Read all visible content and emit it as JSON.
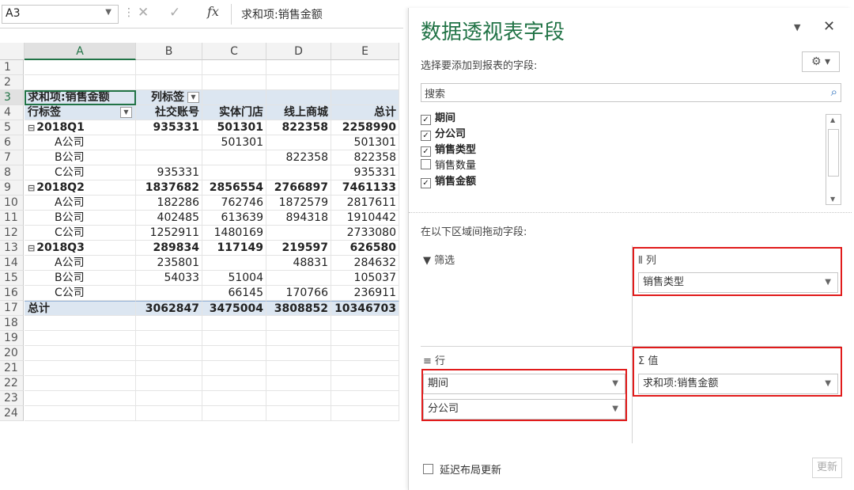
{
  "formula_bar": {
    "name_box": "A3",
    "fx": "fx",
    "formula": "求和项:销售金额"
  },
  "columns": [
    "A",
    "B",
    "C",
    "D",
    "E"
  ],
  "rows": [
    {
      "n": "1",
      "cells": [
        "",
        "",
        "",
        "",
        ""
      ]
    },
    {
      "n": "2",
      "cells": [
        "",
        "",
        "",
        "",
        ""
      ]
    },
    {
      "n": "3",
      "cells": [
        "求和项:销售金额",
        "列标签",
        "",
        "",
        ""
      ]
    },
    {
      "n": "4",
      "cells": [
        "行标签",
        "社交账号",
        "实体门店",
        "线上商城",
        "总计"
      ]
    },
    {
      "n": "5",
      "cells": [
        "2018Q1",
        "935331",
        "501301",
        "822358",
        "2258990"
      ]
    },
    {
      "n": "6",
      "cells": [
        "A公司",
        "",
        "501301",
        "",
        "501301"
      ]
    },
    {
      "n": "7",
      "cells": [
        "B公司",
        "",
        "",
        "822358",
        "822358"
      ]
    },
    {
      "n": "8",
      "cells": [
        "C公司",
        "935331",
        "",
        "",
        "935331"
      ]
    },
    {
      "n": "9",
      "cells": [
        "2018Q2",
        "1837682",
        "2856554",
        "2766897",
        "7461133"
      ]
    },
    {
      "n": "10",
      "cells": [
        "A公司",
        "182286",
        "762746",
        "1872579",
        "2817611"
      ]
    },
    {
      "n": "11",
      "cells": [
        "B公司",
        "402485",
        "613639",
        "894318",
        "1910442"
      ]
    },
    {
      "n": "12",
      "cells": [
        "C公司",
        "1252911",
        "1480169",
        "",
        "2733080"
      ]
    },
    {
      "n": "13",
      "cells": [
        "2018Q3",
        "289834",
        "117149",
        "219597",
        "626580"
      ]
    },
    {
      "n": "14",
      "cells": [
        "A公司",
        "235801",
        "",
        "48831",
        "284632"
      ]
    },
    {
      "n": "15",
      "cells": [
        "B公司",
        "54033",
        "51004",
        "",
        "105037"
      ]
    },
    {
      "n": "16",
      "cells": [
        "C公司",
        "",
        "66145",
        "170766",
        "236911"
      ]
    },
    {
      "n": "17",
      "cells": [
        "总计",
        "3062847",
        "3475004",
        "3808852",
        "10346703"
      ]
    },
    {
      "n": "18",
      "cells": [
        "",
        "",
        "",
        "",
        ""
      ]
    },
    {
      "n": "19",
      "cells": [
        "",
        "",
        "",
        "",
        ""
      ]
    },
    {
      "n": "20",
      "cells": [
        "",
        "",
        "",
        "",
        ""
      ]
    },
    {
      "n": "21",
      "cells": [
        "",
        "",
        "",
        "",
        ""
      ]
    },
    {
      "n": "22",
      "cells": [
        "",
        "",
        "",
        "",
        ""
      ]
    },
    {
      "n": "23",
      "cells": [
        "",
        "",
        "",
        "",
        ""
      ]
    },
    {
      "n": "24",
      "cells": [
        "",
        "",
        "",
        "",
        ""
      ]
    }
  ],
  "pane": {
    "title": "数据透视表字段",
    "subtitle": "选择要添加到报表的字段:",
    "search_placeholder": "搜索",
    "fields": [
      {
        "label": "期间",
        "checked": true
      },
      {
        "label": "分公司",
        "checked": true
      },
      {
        "label": "销售类型",
        "checked": true
      },
      {
        "label": "销售数量",
        "checked": false
      },
      {
        "label": "销售金额",
        "checked": true
      }
    ],
    "drag_label": "在以下区域间拖动字段:",
    "filter_label": "筛选",
    "columns_label": "列",
    "rows_label": "行",
    "values_label": "值",
    "columns_items": [
      "销售类型"
    ],
    "rows_items": [
      "期间",
      "分公司"
    ],
    "values_items": [
      "求和项:销售金额"
    ],
    "defer_label": "延迟布局更新",
    "update_label": "更新"
  },
  "colors": {
    "accent": "#217346",
    "highlight": "#e11b1b",
    "pivot_band": "#dce6f1"
  }
}
